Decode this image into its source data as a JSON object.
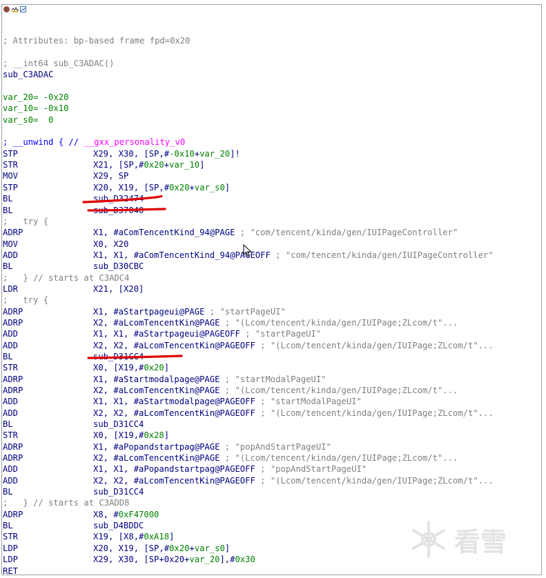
{
  "window": {
    "titlebar_icons": [
      "record-icon",
      "wave-icon",
      "graph-icon"
    ]
  },
  "colors": {
    "comment": "#7f7f7f",
    "code": "#000080",
    "offset_green": "#008000",
    "personality_magenta": "#ff00ff",
    "annotation_red": "#e00000"
  },
  "listing": [
    {
      "kind": "blank"
    },
    {
      "kind": "comment",
      "text": "; Attributes: bp-based frame fpd=0x20"
    },
    {
      "kind": "blank"
    },
    {
      "kind": "comment",
      "text": "; __int64 sub_C3ADAC()"
    },
    {
      "kind": "label",
      "text": "sub_C3ADAC"
    },
    {
      "kind": "blank"
    },
    {
      "kind": "var",
      "name": "var_20=",
      "value": "-0x20"
    },
    {
      "kind": "var",
      "name": "var_10=",
      "value": "-0x10"
    },
    {
      "kind": "var",
      "name": "var_s0=",
      "value": " 0"
    },
    {
      "kind": "blank"
    },
    {
      "kind": "unwind",
      "prefix": "; __unwind { // ",
      "personality": "__gxx_personality_v0"
    },
    {
      "kind": "insn",
      "mnemonic": "STP",
      "operands": "X29, X30, [SP,#-0x10+var_20]!"
    },
    {
      "kind": "insn",
      "mnemonic": "STR",
      "operands": "X21, [SP,#0x20+var_10]"
    },
    {
      "kind": "insn",
      "mnemonic": "MOV",
      "operands": "X29, SP"
    },
    {
      "kind": "insn",
      "mnemonic": "STP",
      "operands": "X20, X19, [SP,#0x20+var_s0]"
    },
    {
      "kind": "insn",
      "mnemonic": "BL",
      "operands": "sub_D32474"
    },
    {
      "kind": "insn",
      "mnemonic": "BL",
      "operands": "sub_D37040"
    },
    {
      "kind": "comment",
      "text": ";   try {"
    },
    {
      "kind": "insn",
      "mnemonic": "ADRP",
      "operands": "X1, #aComTencentKind_94@PAGE",
      "comment": " ; \"com/tencent/kinda/gen/IUIPageController\""
    },
    {
      "kind": "insn",
      "mnemonic": "MOV",
      "operands": "X0, X20"
    },
    {
      "kind": "insn",
      "mnemonic": "ADD",
      "operands": "X1, X1, #aComTencentKind_94@PAGEOFF",
      "comment": " ; \"com/tencent/kinda/gen/IUIPageController\""
    },
    {
      "kind": "insn",
      "mnemonic": "BL",
      "operands": "sub_D30CBC"
    },
    {
      "kind": "comment",
      "text": ";   } // starts at C3ADC4"
    },
    {
      "kind": "insn",
      "mnemonic": "LDR",
      "operands": "X21, [X20]"
    },
    {
      "kind": "comment",
      "text": ";   try {"
    },
    {
      "kind": "insn",
      "mnemonic": "ADRP",
      "operands": "X1, #aStartpageui@PAGE",
      "comment": " ; \"startPageUI\""
    },
    {
      "kind": "insn",
      "mnemonic": "ADRP",
      "operands": "X2, #aLcomTencentKin@PAGE",
      "comment": " ; \"(Lcom/tencent/kinda/gen/IUIPage;ZLcom/t\"..."
    },
    {
      "kind": "insn",
      "mnemonic": "ADD",
      "operands": "X1, X1, #aStartpageui@PAGEOFF",
      "comment": " ; \"startPageUI\""
    },
    {
      "kind": "insn",
      "mnemonic": "ADD",
      "operands": "X2, X2, #aLcomTencentKin@PAGEOFF",
      "comment": " ; \"(Lcom/tencent/kinda/gen/IUIPage;ZLcom/t\"..."
    },
    {
      "kind": "insn",
      "mnemonic": "BL",
      "operands": "sub_D31CC4"
    },
    {
      "kind": "insn",
      "mnemonic": "STR",
      "operands": "X0, [X19,#0x20]"
    },
    {
      "kind": "insn",
      "mnemonic": "ADRP",
      "operands": "X1, #aStartmodalpage@PAGE",
      "comment": " ; \"startModalPageUI\""
    },
    {
      "kind": "insn",
      "mnemonic": "ADRP",
      "operands": "X2, #aLcomTencentKin@PAGE",
      "comment": " ; \"(Lcom/tencent/kinda/gen/IUIPage;ZLcom/t\"..."
    },
    {
      "kind": "insn",
      "mnemonic": "ADD",
      "operands": "X1, X1, #aStartmodalpage@PAGEOFF",
      "comment": " ; \"startModalPageUI\""
    },
    {
      "kind": "insn",
      "mnemonic": "ADD",
      "operands": "X2, X2, #aLcomTencentKin@PAGEOFF",
      "comment": " ; \"(Lcom/tencent/kinda/gen/IUIPage;ZLcom/t\"..."
    },
    {
      "kind": "insn",
      "mnemonic": "BL",
      "operands": "sub_D31CC4"
    },
    {
      "kind": "insn",
      "mnemonic": "STR",
      "operands": "X0, [X19,#0x28]"
    },
    {
      "kind": "insn",
      "mnemonic": "ADRP",
      "operands": "X1, #aPopandstartpag@PAGE",
      "comment": " ; \"popAndStartPageUI\""
    },
    {
      "kind": "insn",
      "mnemonic": "ADRP",
      "operands": "X2, #aLcomTencentKin@PAGE",
      "comment": " ; \"(Lcom/tencent/kinda/gen/IUIPage;ZLcom/t\"..."
    },
    {
      "kind": "insn",
      "mnemonic": "ADD",
      "operands": "X1, X1, #aPopandstartpag@PAGEOFF",
      "comment": " ; \"popAndStartPageUI\""
    },
    {
      "kind": "insn",
      "mnemonic": "ADD",
      "operands": "X2, X2, #aLcomTencentKin@PAGEOFF",
      "comment": " ; \"(Lcom/tencent/kinda/gen/IUIPage;ZLcom/t\"..."
    },
    {
      "kind": "insn",
      "mnemonic": "BL",
      "operands": "sub_D31CC4"
    },
    {
      "kind": "comment",
      "text": ";   } // starts at C3ADD8"
    },
    {
      "kind": "insn",
      "mnemonic": "ADRP",
      "operands": "X8, #0xF47000"
    },
    {
      "kind": "insn",
      "mnemonic": "BL",
      "operands": "sub_D4BDDC"
    },
    {
      "kind": "insn",
      "mnemonic": "STR",
      "operands": "X19, [X8,#0xA18]"
    },
    {
      "kind": "insn",
      "mnemonic": "LDP",
      "operands": "X20, X19, [SP,#0x20+var_s0]"
    },
    {
      "kind": "insn",
      "mnemonic": "LDP",
      "operands": "X29, X30, [SP+0x20+var_20],#0x30"
    },
    {
      "kind": "insn",
      "mnemonic": "RET",
      "operands": ""
    }
  ],
  "watermark": {
    "text": "看雪"
  }
}
